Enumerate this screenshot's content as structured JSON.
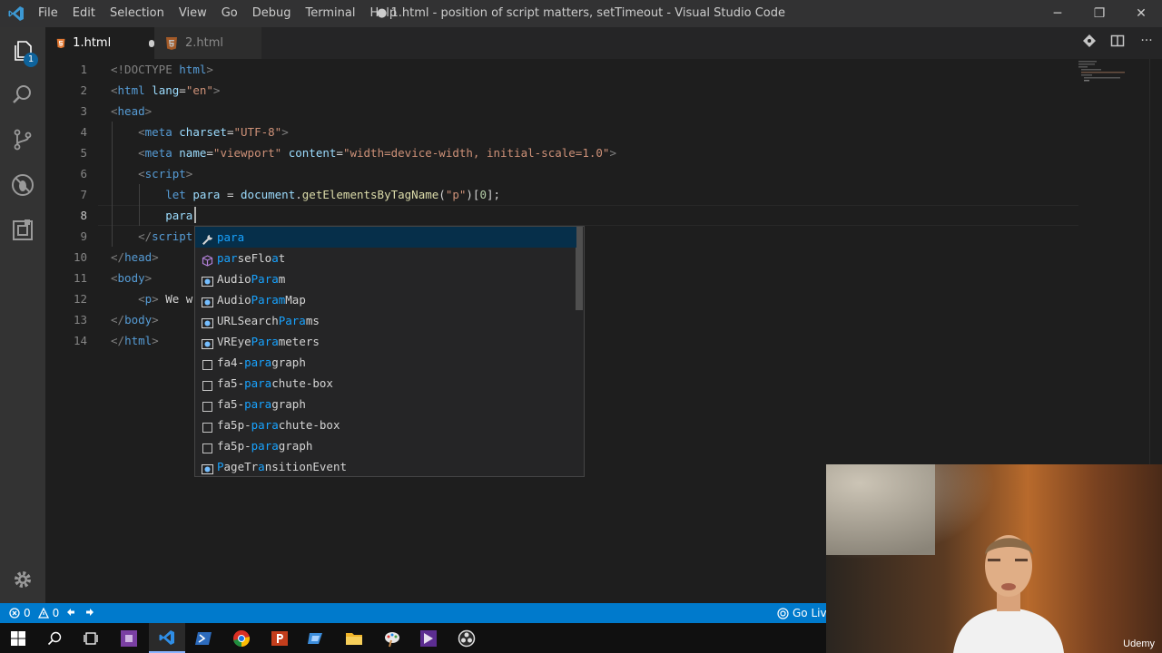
{
  "titlebar": {
    "menu": [
      "File",
      "Edit",
      "Selection",
      "View",
      "Go",
      "Debug",
      "Terminal",
      "Help"
    ],
    "title": "● 1.html - position of script matters, setTimeout - Visual Studio Code",
    "minimize": "─",
    "restore": "❐",
    "close": "✕"
  },
  "activity_bar": {
    "explorer_badge": "1",
    "icons": [
      "files-icon",
      "search-icon",
      "source-control-icon",
      "debug-icon",
      "extensions-icon",
      "settings-gear-icon"
    ]
  },
  "tabs": [
    {
      "label": "1.html",
      "active": true,
      "dirty": true
    },
    {
      "label": "2.html",
      "active": false,
      "dirty": false
    }
  ],
  "tab_actions": {
    "more": "···"
  },
  "editor": {
    "line_numbers": [
      "1",
      "2",
      "3",
      "4",
      "5",
      "6",
      "7",
      "8",
      "9",
      "10",
      "11",
      "12",
      "13",
      "14"
    ],
    "current_line": 8,
    "lines": [
      [
        {
          "t": "<!DOCTYPE ",
          "c": "#808080"
        },
        {
          "t": "html",
          "c": "#569cd6"
        },
        {
          "t": ">",
          "c": "#808080"
        }
      ],
      [
        {
          "t": "<",
          "c": "#808080"
        },
        {
          "t": "html",
          "c": "#569cd6"
        },
        {
          "t": " ",
          "c": "#d4d4d4"
        },
        {
          "t": "lang",
          "c": "#9cdcfe"
        },
        {
          "t": "=",
          "c": "#d4d4d4"
        },
        {
          "t": "\"en\"",
          "c": "#ce9178"
        },
        {
          "t": ">",
          "c": "#808080"
        }
      ],
      [
        {
          "t": "<",
          "c": "#808080"
        },
        {
          "t": "head",
          "c": "#569cd6"
        },
        {
          "t": ">",
          "c": "#808080"
        }
      ],
      [
        {
          "t": "    <",
          "c": "#808080"
        },
        {
          "t": "meta",
          "c": "#569cd6"
        },
        {
          "t": " ",
          "c": "#d4d4d4"
        },
        {
          "t": "charset",
          "c": "#9cdcfe"
        },
        {
          "t": "=",
          "c": "#d4d4d4"
        },
        {
          "t": "\"UTF-8\"",
          "c": "#ce9178"
        },
        {
          "t": ">",
          "c": "#808080"
        }
      ],
      [
        {
          "t": "    <",
          "c": "#808080"
        },
        {
          "t": "meta",
          "c": "#569cd6"
        },
        {
          "t": " ",
          "c": "#d4d4d4"
        },
        {
          "t": "name",
          "c": "#9cdcfe"
        },
        {
          "t": "=",
          "c": "#d4d4d4"
        },
        {
          "t": "\"viewport\"",
          "c": "#ce9178"
        },
        {
          "t": " ",
          "c": "#d4d4d4"
        },
        {
          "t": "content",
          "c": "#9cdcfe"
        },
        {
          "t": "=",
          "c": "#d4d4d4"
        },
        {
          "t": "\"width=device-width, initial-scale=1.0\"",
          "c": "#ce9178"
        },
        {
          "t": ">",
          "c": "#808080"
        }
      ],
      [
        {
          "t": "    <",
          "c": "#808080"
        },
        {
          "t": "script",
          "c": "#569cd6"
        },
        {
          "t": ">",
          "c": "#808080"
        }
      ],
      [
        {
          "t": "        ",
          "c": "#d4d4d4"
        },
        {
          "t": "let",
          "c": "#569cd6"
        },
        {
          "t": " ",
          "c": "#d4d4d4"
        },
        {
          "t": "para",
          "c": "#9cdcfe"
        },
        {
          "t": " = ",
          "c": "#d4d4d4"
        },
        {
          "t": "document",
          "c": "#9cdcfe"
        },
        {
          "t": ".",
          "c": "#d4d4d4"
        },
        {
          "t": "getElementsByTagName",
          "c": "#dcdcaa"
        },
        {
          "t": "(",
          "c": "#d4d4d4"
        },
        {
          "t": "\"p\"",
          "c": "#ce9178"
        },
        {
          "t": ")[",
          "c": "#d4d4d4"
        },
        {
          "t": "0",
          "c": "#b5cea8"
        },
        {
          "t": "];",
          "c": "#d4d4d4"
        }
      ],
      [
        {
          "t": "        ",
          "c": "#d4d4d4"
        },
        {
          "t": "para",
          "c": "#9cdcfe"
        }
      ],
      [
        {
          "t": "    </",
          "c": "#808080"
        },
        {
          "t": "script",
          "c": "#569cd6"
        }
      ],
      [
        {
          "t": "</",
          "c": "#808080"
        },
        {
          "t": "head",
          "c": "#569cd6"
        },
        {
          "t": ">",
          "c": "#808080"
        }
      ],
      [
        {
          "t": "<",
          "c": "#808080"
        },
        {
          "t": "body",
          "c": "#569cd6"
        },
        {
          "t": ">",
          "c": "#808080"
        }
      ],
      [
        {
          "t": "    <",
          "c": "#808080"
        },
        {
          "t": "p",
          "c": "#569cd6"
        },
        {
          "t": ">",
          "c": "#808080"
        },
        {
          "t": " We w",
          "c": "#d4d4d4"
        }
      ],
      [
        {
          "t": "</",
          "c": "#808080"
        },
        {
          "t": "body",
          "c": "#569cd6"
        },
        {
          "t": ">",
          "c": "#808080"
        }
      ],
      [
        {
          "t": "</",
          "c": "#808080"
        },
        {
          "t": "html",
          "c": "#569cd6"
        },
        {
          "t": ">",
          "c": "#808080"
        }
      ]
    ]
  },
  "suggestions": [
    {
      "parts": [
        [
          "para",
          true
        ]
      ],
      "kind": "variable",
      "selected": true
    },
    {
      "parts": [
        [
          "par",
          true
        ],
        [
          "seFlo",
          false
        ],
        [
          "a",
          true
        ],
        [
          "t",
          false
        ]
      ],
      "kind": "function"
    },
    {
      "parts": [
        [
          "AudioParam",
          false
        ],
        [
          "m",
          false
        ]
      ],
      "hlparts": [
        [
          "Audio",
          false
        ],
        [
          "Par",
          true
        ],
        [
          "a",
          true
        ],
        [
          "m",
          false
        ]
      ],
      "kind": "class"
    },
    {
      "parts": [
        [
          "Audio",
          false
        ],
        [
          "Param",
          true
        ],
        [
          "Map",
          false
        ]
      ],
      "kind": "class"
    },
    {
      "parts": [
        [
          "URLSearch",
          false
        ],
        [
          "Para",
          true
        ],
        [
          "ms",
          false
        ]
      ],
      "kind": "class"
    },
    {
      "parts": [
        [
          "VREye",
          false
        ],
        [
          "Para",
          true
        ],
        [
          "meters",
          false
        ]
      ],
      "kind": "class"
    },
    {
      "parts": [
        [
          "fa4-",
          false
        ],
        [
          "para",
          true
        ],
        [
          "graph",
          false
        ]
      ],
      "kind": "snippet"
    },
    {
      "parts": [
        [
          "fa5-",
          false
        ],
        [
          "para",
          true
        ],
        [
          "chute-box",
          false
        ]
      ],
      "kind": "snippet"
    },
    {
      "parts": [
        [
          "fa5-",
          false
        ],
        [
          "para",
          true
        ],
        [
          "graph",
          false
        ]
      ],
      "kind": "snippet"
    },
    {
      "parts": [
        [
          "fa5p-",
          false
        ],
        [
          "para",
          true
        ],
        [
          "chute-box",
          false
        ]
      ],
      "kind": "snippet"
    },
    {
      "parts": [
        [
          "fa5p-",
          false
        ],
        [
          "para",
          true
        ],
        [
          "graph",
          false
        ]
      ],
      "kind": "snippet"
    },
    {
      "parts": [
        [
          "P",
          true
        ],
        [
          "ageTr",
          false
        ],
        [
          "a",
          true
        ],
        [
          "nsitionEvent",
          false
        ]
      ],
      "kind": "class"
    }
  ],
  "statusbar": {
    "errors": "0",
    "warnings": "0",
    "go_live": "Go Live"
  },
  "taskbar": {
    "apps": [
      "windows-start-icon",
      "search-icon",
      "task-view-icon",
      "visual-studio-icon",
      "vscode-icon",
      "powershell-icon",
      "chrome-icon",
      "powerpoint-icon",
      "visual-studio-installer-icon",
      "file-explorer-icon",
      "paint-icon",
      "visual-studio-2-icon",
      "obs-icon"
    ]
  },
  "webcam": {
    "watermark": "Udemy"
  }
}
